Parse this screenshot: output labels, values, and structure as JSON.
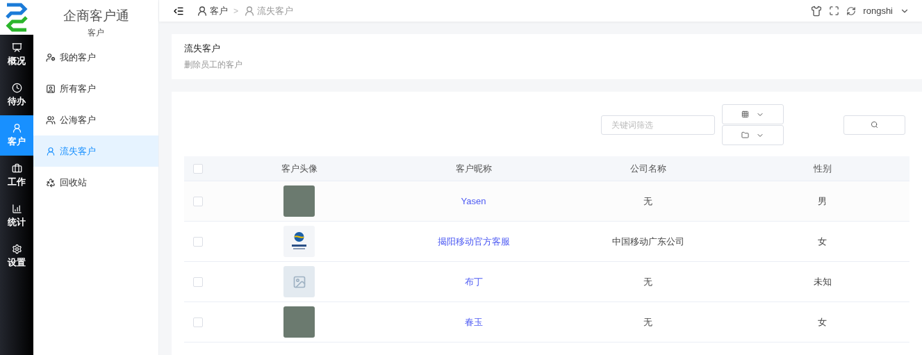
{
  "app": {
    "title": "企商客户通",
    "section": "客户"
  },
  "rail": [
    {
      "label": "概况",
      "selected": false
    },
    {
      "label": "待办",
      "selected": false
    },
    {
      "label": "客户",
      "selected": true
    },
    {
      "label": "工作",
      "selected": false
    },
    {
      "label": "统计",
      "selected": false
    },
    {
      "label": "设置",
      "selected": false
    }
  ],
  "submenu": [
    {
      "label": "我的客户",
      "selected": false
    },
    {
      "label": "所有客户",
      "selected": false
    },
    {
      "label": "公海客户",
      "selected": false
    },
    {
      "label": "流失客户",
      "selected": true
    },
    {
      "label": "回收站",
      "selected": false
    }
  ],
  "breadcrumb": [
    {
      "label": "客户",
      "current": false
    },
    {
      "label": "流失客户",
      "current": true
    }
  ],
  "breadcrumb_separator": ">",
  "user": {
    "name": "rongshi"
  },
  "page": {
    "title": "流失客户",
    "subtitle": "删除员工的客户"
  },
  "filter": {
    "placeholder": "关键词筛选"
  },
  "table": {
    "all_checked": false,
    "columns": [
      "客户头像",
      "客户昵称",
      "公司名称",
      "性别"
    ],
    "rows": [
      {
        "kind": "photo",
        "nickname": "Yasen",
        "company": "无",
        "gender": "男",
        "checked": false
      },
      {
        "kind": "logo",
        "nickname": "揭阳移动官方客服",
        "company": "中国移动广东公司",
        "gender": "女",
        "checked": false
      },
      {
        "kind": "placeholder",
        "nickname": "布丁",
        "company": "无",
        "gender": "未知",
        "checked": false
      },
      {
        "kind": "photo",
        "nickname": "春玉",
        "company": "无",
        "gender": "女",
        "checked": false
      }
    ]
  }
}
